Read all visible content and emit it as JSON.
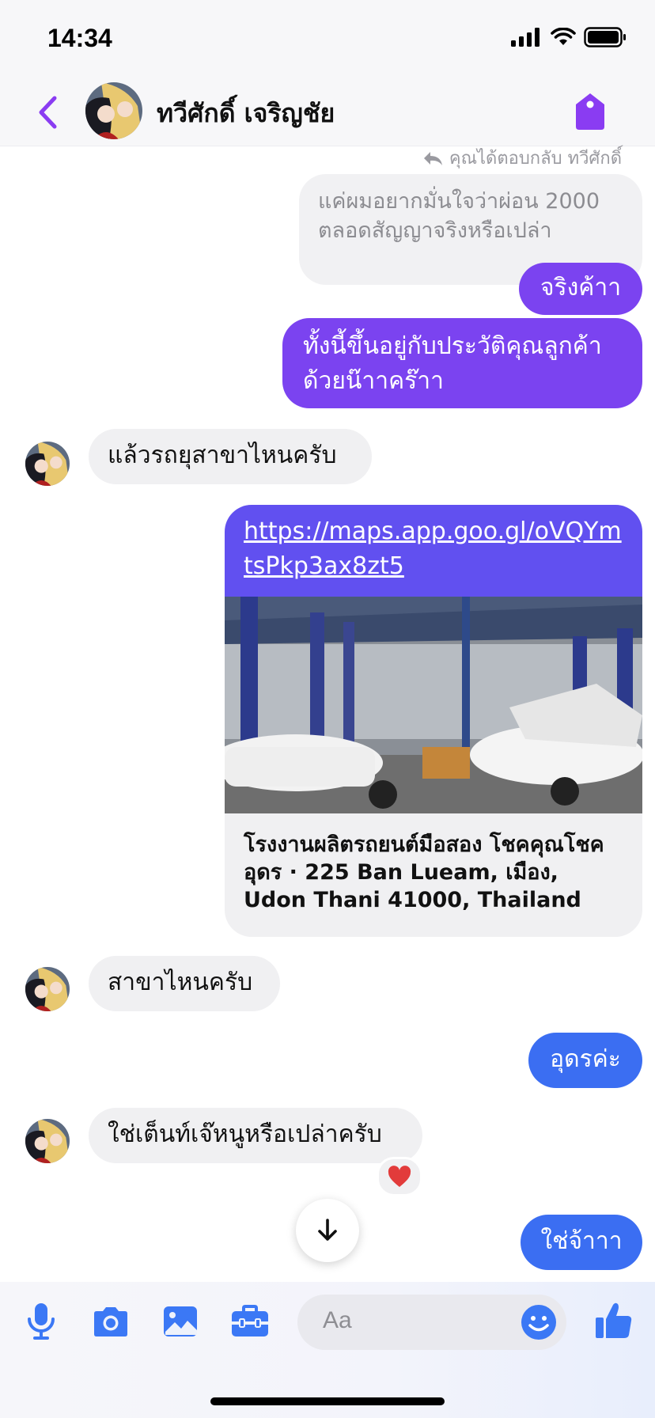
{
  "status": {
    "time": "14:34"
  },
  "header": {
    "contact_name": "ทวีศักดิ์ เจริญชัย"
  },
  "reply_note": "คุณได้ตอบกลับ ทวีศักดิ์",
  "quoted_message": "แค่ผมอยากมั่นใจว่าผ่อน 2000 ตลอดสัญญาจริงหรือเปล่า",
  "messages": [
    {
      "text": "จริงค้าา"
    },
    {
      "text": "ทั้งนี้ขึ้นอยู่กับประวัติคุณลูกค้าด้วยน๊าาคร๊าา"
    },
    {
      "text": "แล้วรถยุสาขาไหนครับ"
    },
    {
      "text": "สาขาไหนครับ"
    },
    {
      "text": "อุดรค่ะ"
    },
    {
      "text": "ใช่เต็นท์เจ๊หนูหรือเปล่าครับ"
    },
    {
      "text": "ใช่จ้าาา"
    }
  ],
  "link_card": {
    "url": "https://maps.app.goo.gl/oVQYmtsPkp3ax8zt5",
    "description": "โรงงานผลิตรถยนต์มือสอง โชคคุณโชคอุดร · 225 Ban Lueam, เมือง, Udon Thani 41000, Thailand"
  },
  "reaction": "❤️",
  "composer": {
    "placeholder": "Aa"
  },
  "colors": {
    "accent_purple": "#7b43f0",
    "accent_blue": "#3b6ef2",
    "link_card": "#6150f0",
    "icon_blue": "#3b78f5"
  }
}
